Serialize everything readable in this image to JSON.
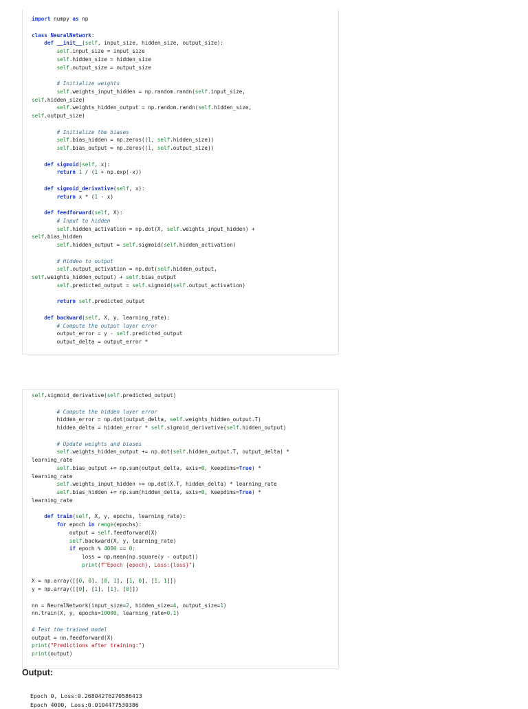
{
  "code_block_1": {
    "lines": [
      "import numpy as np",
      "",
      "class NeuralNetwork:",
      "    def __init__(self, input_size, hidden_size, output_size):",
      "        self.input_size = input_size",
      "        self.hidden_size = hidden_size",
      "        self.output_size = output_size",
      "",
      "        # Initialize weights",
      "        self.weights_input_hidden = np.random.randn(self.input_size,",
      "self.hidden_size)",
      "        self.weights_hidden_output = np.random.randn(self.hidden_size,",
      "self.output_size)",
      "",
      "        # Initialize the biases",
      "        self.bias_hidden = np.zeros((1, self.hidden_size))",
      "        self.bias_output = np.zeros((1, self.output_size))",
      "",
      "    def sigmoid(self, x):",
      "        return 1 / (1 + np.exp(-x))",
      "",
      "    def sigmoid_derivative(self, x):",
      "        return x * (1 - x)",
      "",
      "    def feedforward(self, X):",
      "        # Input to hidden",
      "        self.hidden_activation = np.dot(X, self.weights_input_hidden) +",
      "self.bias_hidden",
      "        self.hidden_output = self.sigmoid(self.hidden_activation)",
      "",
      "        # Hidden to output",
      "        self.output_activation = np.dot(self.hidden_output,",
      "self.weights_hidden_output) + self.bias_output",
      "        self.predicted_output = self.sigmoid(self.output_activation)",
      "",
      "        return self.predicted_output",
      "",
      "    def backward(self, X, y, learning_rate):",
      "        # Compute the output layer error",
      "        output_error = y - self.predicted_output",
      "        output_delta = output_error *"
    ]
  },
  "code_block_2": {
    "lines": [
      "self.sigmoid_derivative(self.predicted_output)",
      "",
      "        # Compute the hidden layer error",
      "        hidden_error = np.dot(output_delta, self.weights_hidden_output.T)",
      "        hidden_delta = hidden_error * self.sigmoid_derivative(self.hidden_output)",
      "",
      "        # Update weights and biases",
      "        self.weights_hidden_output += np.dot(self.hidden_output.T, output_delta) *",
      "learning_rate",
      "        self.bias_output += np.sum(output_delta, axis=0, keepdims=True) *",
      "learning_rate",
      "        self.weights_input_hidden += np.dot(X.T, hidden_delta) * learning_rate",
      "        self.bias_hidden += np.sum(hidden_delta, axis=0, keepdims=True) *",
      "learning_rate",
      "",
      "    def train(self, X, y, epochs, learning_rate):",
      "        for epoch in range(epochs):",
      "            output = self.feedforward(X)",
      "            self.backward(X, y, learning_rate)",
      "            if epoch % 4000 == 0:",
      "                loss = np.mean(np.square(y - output))",
      "                print(f\"Epoch {epoch}, Loss:{loss}\")",
      "",
      "X = np.array([[0, 0], [0, 1], [1, 0], [1, 1]])",
      "y = np.array([[0], [1], [1], [0]])",
      "",
      "nn = NeuralNetwork(input_size=2, hidden_size=4, output_size=1)",
      "nn.train(X, y, epochs=10000, learning_rate=0.1)",
      "",
      "# Test the trained model",
      "output = nn.feedforward(X)",
      "print(\"Predictions after training:\")",
      "print(output)"
    ]
  },
  "output_section": {
    "label": "Output:",
    "lines": [
      "Epoch 0, Loss:0.26804276270586413",
      "Epoch 4000, Loss:0.0104477530386"
    ]
  }
}
